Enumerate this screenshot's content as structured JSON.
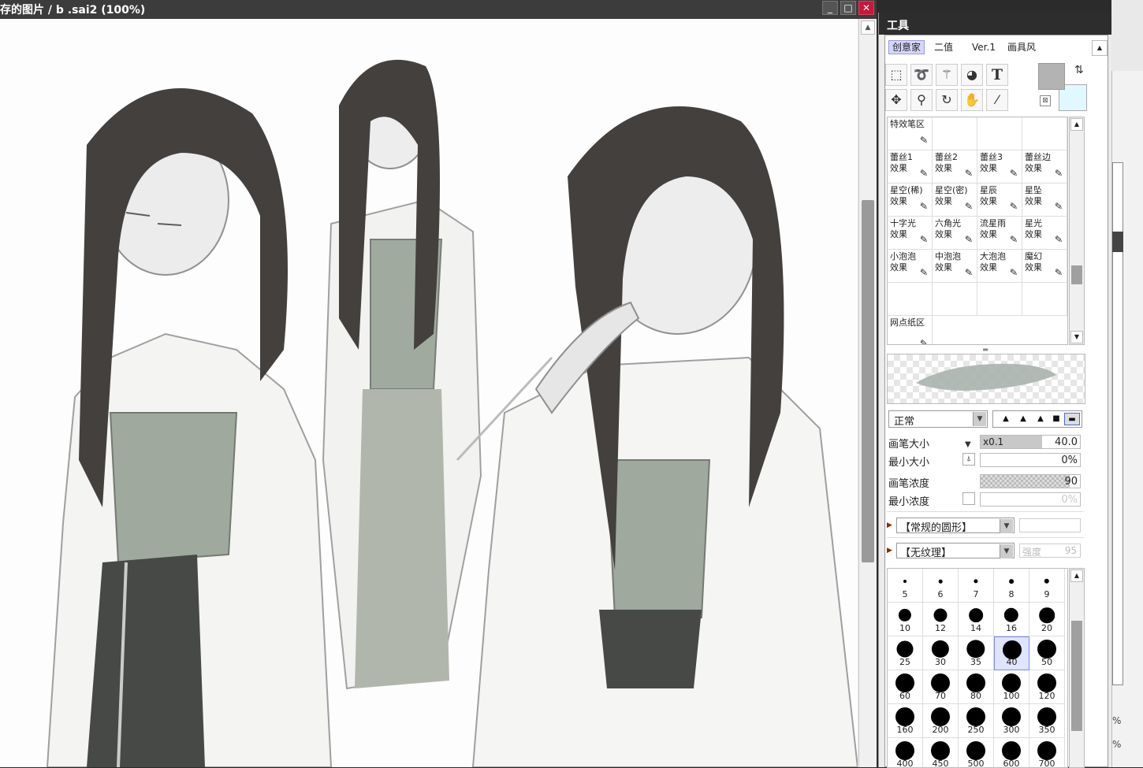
{
  "canvas_window": {
    "title": "存的图片 / b .sai2 (100%)",
    "minimize": "_",
    "maximize": "□",
    "close": "✕"
  },
  "tool_panel": {
    "header": "工具",
    "tabs": [
      {
        "label": "创意家",
        "active": true
      },
      {
        "label": "二值",
        "active": false
      },
      {
        "label": "Ver.1",
        "active": false
      },
      {
        "label": "画具风",
        "active": false
      }
    ],
    "tools_row1": [
      {
        "name": "rect-select-tool",
        "glyph": "⬚"
      },
      {
        "name": "lasso-tool",
        "glyph": "➰"
      },
      {
        "name": "magic-wand-tool",
        "glyph": "⚚"
      },
      {
        "name": "shape-tool",
        "glyph": "◕"
      },
      {
        "name": "text-tool",
        "glyph": "T"
      }
    ],
    "tools_row2": [
      {
        "name": "move-tool",
        "glyph": "✥"
      },
      {
        "name": "zoom-tool",
        "glyph": "⚲"
      },
      {
        "name": "rotate-tool",
        "glyph": "↻"
      },
      {
        "name": "hand-tool",
        "glyph": "✋"
      },
      {
        "name": "eyedropper-tool",
        "glyph": "⁄"
      }
    ],
    "colors": {
      "primary": "#b3b3b3",
      "secondary": "#e0f8ff"
    },
    "brush_sections": {
      "effects_section": "特效笔区",
      "screentone_section": "网点纸区"
    },
    "brushes": [
      [
        {
          "name": "蕾丝1",
          "sub": "效果"
        },
        {
          "name": "蕾丝2",
          "sub": "效果"
        },
        {
          "name": "蕾丝3",
          "sub": "效果"
        },
        {
          "name": "蕾丝边",
          "sub": "效果"
        }
      ],
      [
        {
          "name": "星空(稀)",
          "sub": "效果"
        },
        {
          "name": "星空(密)",
          "sub": "效果"
        },
        {
          "name": "星辰",
          "sub": "效果"
        },
        {
          "name": "星坠",
          "sub": "效果"
        }
      ],
      [
        {
          "name": "十字光",
          "sub": "效果"
        },
        {
          "name": "六角光",
          "sub": "效果"
        },
        {
          "name": "流星雨",
          "sub": "效果"
        },
        {
          "name": "星光",
          "sub": "效果"
        }
      ],
      [
        {
          "name": "小泡泡",
          "sub": "效果"
        },
        {
          "name": "中泡泡",
          "sub": "效果"
        },
        {
          "name": "大泡泡",
          "sub": "效果"
        },
        {
          "name": "魔幻",
          "sub": "效果"
        }
      ]
    ],
    "blend_mode": "正常",
    "shapes": [
      "▲",
      "▲",
      "▲",
      "■",
      "▬"
    ],
    "params": {
      "brush_size": {
        "label": "画笔大小",
        "prefix": "x0.1",
        "value": "40.0",
        "fraction": 0.62
      },
      "min_size": {
        "label": "最小大小",
        "value": "0%",
        "fraction": 0
      },
      "density": {
        "label": "画笔浓度",
        "value": "90",
        "fraction": 0.9
      },
      "min_density": {
        "label": "最小浓度",
        "value": "0%",
        "fraction": 0
      }
    },
    "shape_combo": "【常规的圆形】",
    "texture_combo": "【无纹理】",
    "texture_strength_label": "强度",
    "texture_strength_value": "95",
    "sizes": [
      [
        "5",
        "6",
        "7",
        "8",
        "9"
      ],
      [
        "10",
        "12",
        "14",
        "16",
        "20"
      ],
      [
        "25",
        "30",
        "35",
        "40",
        "50"
      ],
      [
        "60",
        "70",
        "80",
        "100",
        "120"
      ],
      [
        "160",
        "200",
        "250",
        "300",
        "350"
      ],
      [
        "400",
        "450",
        "500",
        "600",
        "700"
      ]
    ],
    "selected_size": "40"
  },
  "edge_window": {
    "pct_1": "%",
    "pct_2": "%"
  }
}
